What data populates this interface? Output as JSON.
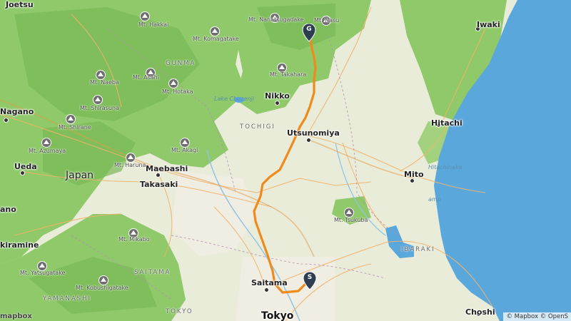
{
  "map": {
    "colors": {
      "land": "#e9ecd9",
      "forest": "#8fc96a",
      "forest_dark": "#74b553",
      "sea": "#5aa7dc",
      "road_major": "#f2b36b",
      "route": "#f08a1c",
      "pin": "#2c3e50"
    },
    "route_markers": [
      {
        "letter": "S",
        "name": "start"
      },
      {
        "letter": "G",
        "name": "goal"
      }
    ],
    "labels": {
      "cities": [
        {
          "id": "joetsu",
          "text": "Joetsu"
        },
        {
          "id": "nagano",
          "text": "Nagano"
        },
        {
          "id": "ueda",
          "text": "Ueda"
        },
        {
          "id": "nikko",
          "text": "Nikko"
        },
        {
          "id": "utsunomiya",
          "text": "Utsunomiya"
        },
        {
          "id": "maebashi",
          "text": "Maebashi"
        },
        {
          "id": "takasaki",
          "text": "Takasaki"
        },
        {
          "id": "mito",
          "text": "Mito"
        },
        {
          "id": "hitachi",
          "text": "Hitachi"
        },
        {
          "id": "iwaki",
          "text": "Iwaki"
        },
        {
          "id": "saitama",
          "text": "Saitama"
        },
        {
          "id": "choshi",
          "text": "Choshi"
        },
        {
          "id": "ano",
          "text": "ano"
        },
        {
          "id": "kiramine",
          "text": "kiramine"
        }
      ],
      "big": [
        {
          "id": "tokyo",
          "text": "Tokyo"
        }
      ],
      "country": [
        {
          "id": "japan",
          "text": "Japan"
        }
      ],
      "prefectures": [
        {
          "id": "gunma",
          "text": "GUNMA"
        },
        {
          "id": "tochigi",
          "text": "TOCHIGI"
        },
        {
          "id": "ibaraki",
          "text": "IBARAKI"
        },
        {
          "id": "saitama-pref",
          "text": "SAITAMA"
        },
        {
          "id": "yamanashi",
          "text": "YAMANASHI"
        },
        {
          "id": "tokyo-pref",
          "text": "TOKYO"
        }
      ],
      "mountains": [
        {
          "id": "hakkai",
          "text": "Mt. Hakkai"
        },
        {
          "id": "komagatake",
          "text": "Mt. Komagatake"
        },
        {
          "id": "nanatsugadake",
          "text": "Mt. Nanatsugadake"
        },
        {
          "id": "nasu",
          "text": "Mt. Nasu"
        },
        {
          "id": "asahi",
          "text": "Mt. Asahi"
        },
        {
          "id": "hotaka",
          "text": "Mt. Hotaka"
        },
        {
          "id": "naeba",
          "text": "Mt. Naeba"
        },
        {
          "id": "takahara",
          "text": "Mt. Takahara"
        },
        {
          "id": "shirasuna",
          "text": "Mt. Shirasuna"
        },
        {
          "id": "shirane",
          "text": "Mt. Shirane"
        },
        {
          "id": "azumaya",
          "text": "Mt. Azumaya"
        },
        {
          "id": "akagi",
          "text": "Mt. Akagi"
        },
        {
          "id": "haruna",
          "text": "Mt. Haruna"
        },
        {
          "id": "tsukuba",
          "text": "Mt. Tsukuba"
        },
        {
          "id": "mikabo",
          "text": "Mt. Mikabo"
        },
        {
          "id": "yatsugatake",
          "text": "Mt. Yatsugatake"
        },
        {
          "id": "kobushigatake",
          "text": "Mt. Kobushigatake"
        }
      ],
      "water": [
        {
          "id": "lake-chuzenji",
          "text": "Lake Chuzenji"
        },
        {
          "id": "hitachinaka",
          "text": "Hitachinaka"
        },
        {
          "id": "swamp",
          "text": "amp"
        }
      ]
    },
    "logo": "mapbox",
    "attribution": "© Mapbox © OpenS"
  }
}
